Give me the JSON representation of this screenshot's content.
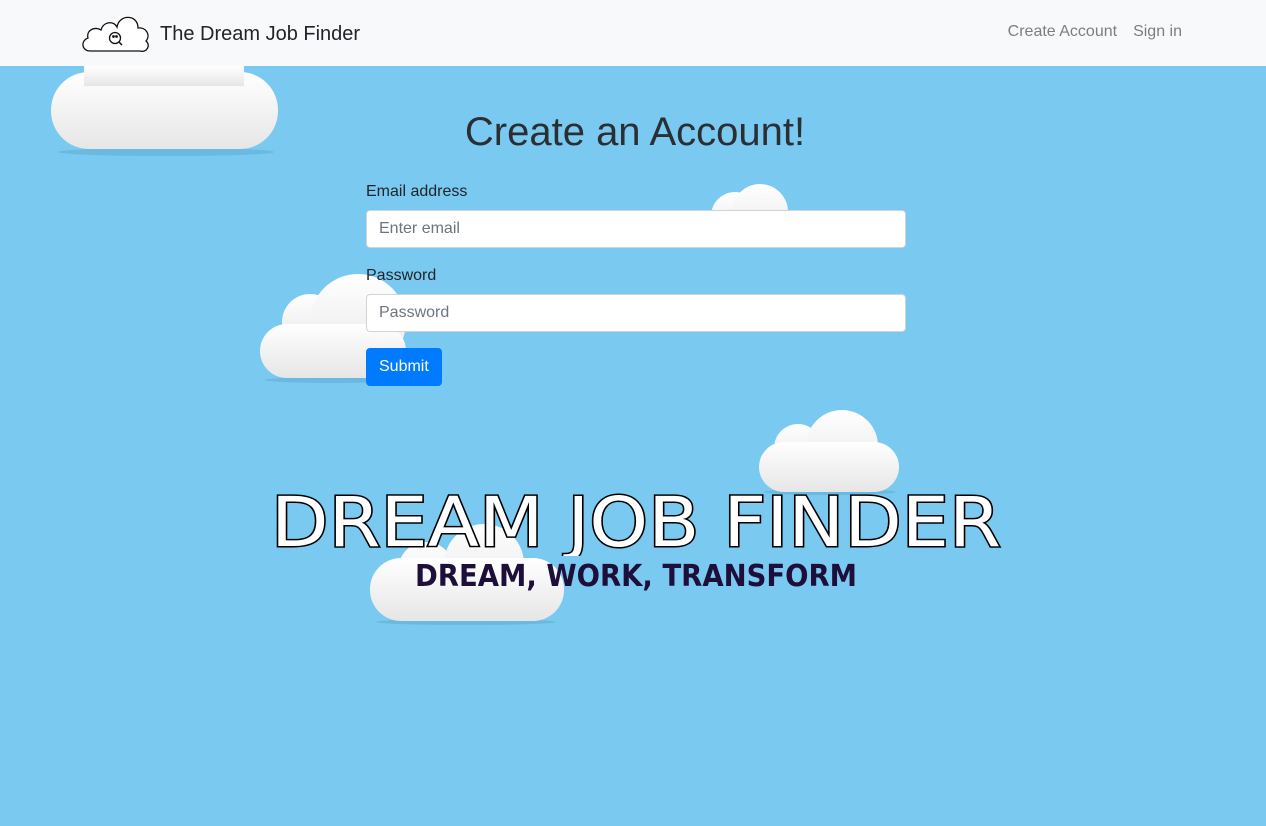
{
  "navbar": {
    "brand_text": "The Dream Job Finder",
    "brand_icon": "cloud-logo-icon",
    "links": [
      {
        "label": "Create Account"
      },
      {
        "label": "Sign in"
      }
    ]
  },
  "main": {
    "title": "Create an Account!",
    "email": {
      "label": "Email address",
      "placeholder": "Enter email",
      "value": ""
    },
    "password": {
      "label": "Password",
      "placeholder": "Password",
      "value": ""
    },
    "submit_label": "Submit"
  },
  "branding": {
    "headline": "DREAM JOB FINDER",
    "tagline": "DREAM, WORK, TRANSFORM"
  },
  "colors": {
    "sky": "#79c9f0",
    "navbar_bg": "#f8f9fa",
    "primary": "#007bff",
    "tagline": "#1d0f3a"
  }
}
